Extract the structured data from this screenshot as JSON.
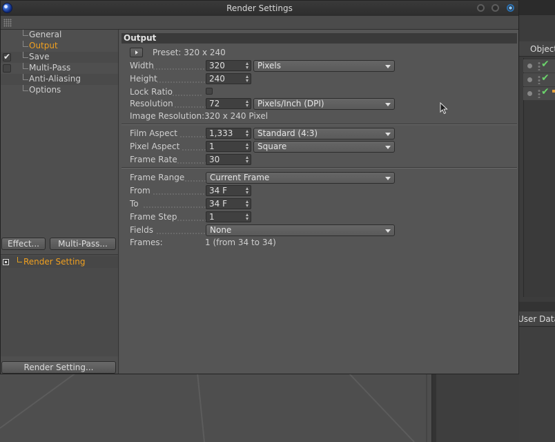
{
  "dialog": {
    "title": "Render Settings"
  },
  "sidebar": {
    "items": [
      {
        "label": "General",
        "checkbox": null,
        "selected": false
      },
      {
        "label": "Output",
        "checkbox": null,
        "selected": true
      },
      {
        "label": "Save",
        "checkbox": true,
        "selected": false
      },
      {
        "label": "Multi-Pass",
        "checkbox": false,
        "selected": false
      },
      {
        "label": "Anti-Aliasing",
        "checkbox": null,
        "selected": false
      },
      {
        "label": "Options",
        "checkbox": null,
        "selected": false
      }
    ],
    "effect_button": "Effect...",
    "multipass_button": "Multi-Pass...",
    "setting_item": "Render Setting",
    "render_setting_button": "Render Setting..."
  },
  "output": {
    "section_title": "Output",
    "preset": "Preset: 320 x 240",
    "width": {
      "label": "Width",
      "value": "320",
      "unit": "Pixels"
    },
    "height": {
      "label": "Height",
      "value": "240"
    },
    "lock_ratio": {
      "label": "Lock Ratio",
      "checked": false
    },
    "resolution": {
      "label": "Resolution",
      "value": "72",
      "unit": "Pixels/Inch (DPI)"
    },
    "image_resolution": {
      "label": "Image Resolution:",
      "value": "320 x 240 Pixel"
    },
    "film_aspect": {
      "label": "Film Aspect",
      "value": "1,333",
      "option": "Standard (4:3)"
    },
    "pixel_aspect": {
      "label": "Pixel Aspect",
      "value": "1",
      "option": "Square"
    },
    "frame_rate": {
      "label": "Frame Rate",
      "value": "30"
    },
    "frame_range": {
      "label": "Frame Range",
      "option": "Current Frame"
    },
    "from": {
      "label": "From",
      "value": "34 F"
    },
    "to": {
      "label": "To",
      "value": "34 F"
    },
    "frame_step": {
      "label": "Frame Step",
      "value": "1"
    },
    "fields": {
      "label": "Fields",
      "option": "None"
    },
    "frames": {
      "label": "Frames:",
      "value": "1 (from 34 to 34)"
    }
  },
  "background": {
    "objects_tab": "Objects",
    "attributes_tab": "User Data"
  },
  "colors": {
    "accent": "#f0a020",
    "panel": "#535353",
    "check_green": "#6bd36b"
  }
}
